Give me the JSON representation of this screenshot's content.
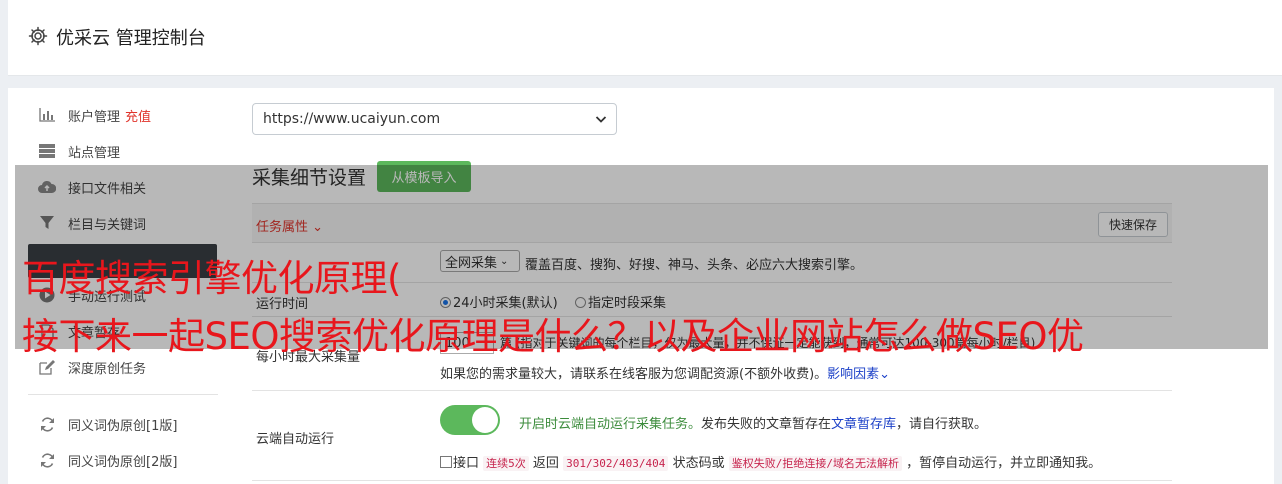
{
  "header": {
    "title": "优采云 管理控制台",
    "icon": "gear-icon"
  },
  "sidebar": {
    "items": [
      {
        "label": "账户管理",
        "badge": "充值",
        "icon": "bar-chart-icon"
      },
      {
        "label": "站点管理",
        "icon": "server-icon"
      },
      {
        "label": "接口文件相关",
        "icon": "cloud-upload-icon"
      },
      {
        "label": "栏目与关键词",
        "icon": "filter-icon"
      },
      {
        "label": "手动运行测试",
        "icon": "play-circle-icon"
      },
      {
        "label": "文章暂存",
        "icon": "file-icon"
      },
      {
        "label": "深度原创任务",
        "icon": "edit-icon"
      },
      {
        "label": "同义词伪原创[1版]",
        "icon": "refresh-icon"
      },
      {
        "label": "同义词伪原创[2版]",
        "icon": "refresh-icon"
      }
    ]
  },
  "site_select": {
    "value": "https://www.ucaiyun.com"
  },
  "section": {
    "title": "采集细节设置",
    "import_button": "从模板导入",
    "task_props_label": "任务属性",
    "quick_save": "快速保存"
  },
  "rows": {
    "source_select": "全网采集",
    "source_desc": "覆盖百度、搜狗、好搜、神马、头条、必应六大搜索引擎。",
    "run_time_label": "运行时间",
    "run_time_opt1": "24小时采集(默认)",
    "run_time_opt2": "指定时段采集",
    "max_label": "每小时最大采集量",
    "max_value": "100",
    "max_desc": "篇 (指对于关键词的每个栏目，仅为最大量，并不保证一定能获到，通常可达100-300篇每小时/栏目)",
    "max_help": "如果您的需求量较大，请联系在线客服为您调配资源(不额外收费)。",
    "max_help_link": "影响因素",
    "cloud_label": "云端自动运行",
    "cloud_green": "开启时云端自动运行采集任务。",
    "cloud_desc": "发布失败的文章暂存在",
    "cloud_link": "文章暂存库",
    "cloud_desc2": "，请自行获取。",
    "cb_prefix": "接口",
    "cb_code1": "连续5次",
    "cb_mid1": "返回",
    "cb_code2": "301/302/403/404",
    "cb_mid2": "状态码或",
    "cb_code3": "鉴权失败/拒绝连接/域名无法解析",
    "cb_suffix": "，暂停自动运行，并立即通知我。"
  },
  "overlay": {
    "line1": "百度搜索引擎优化原理(",
    "line2": "接下来一起SEO搜索优化原理是什么？以及企业网站怎么做SEO优"
  },
  "colors": {
    "accent_red": "#e0342b",
    "green": "#5cb85c",
    "link": "#1a3fc7",
    "overlay_text": "#e8161c"
  }
}
